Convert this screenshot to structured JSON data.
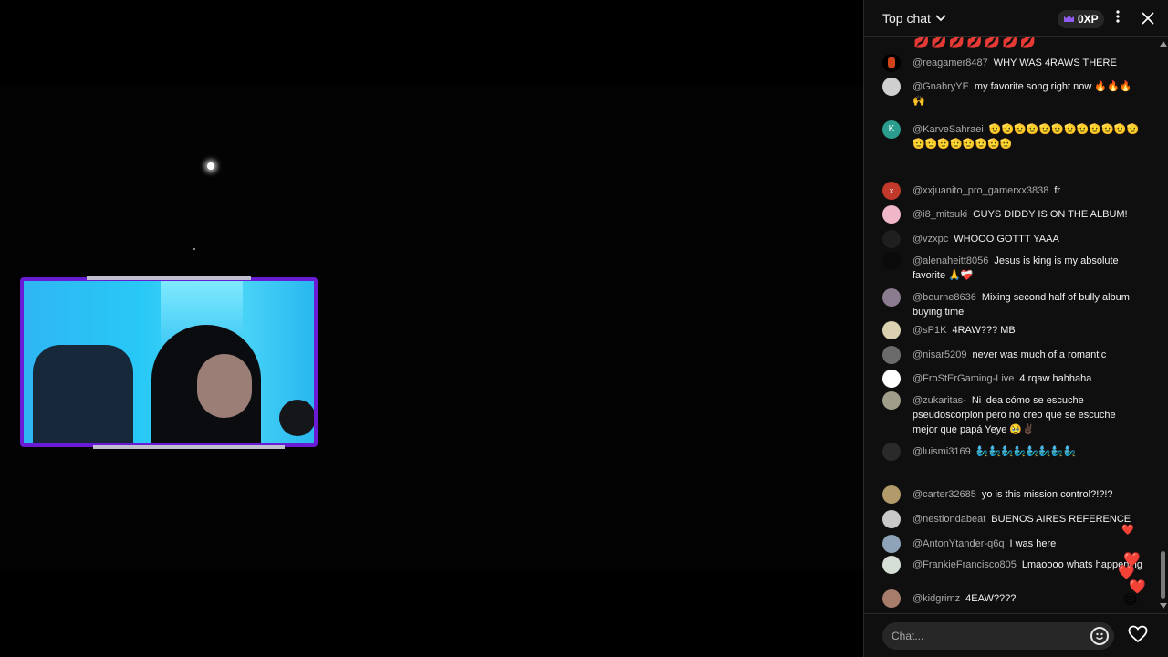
{
  "header": {
    "title": "Top chat",
    "xp": "0XP",
    "menu_icon": "more-vert-icon",
    "close_icon": "close-icon"
  },
  "emoji_strip": "💋💋💋💋💋💋💋",
  "messages": [
    {
      "author": "@reagamer8487",
      "text": "WHY WAS 4RAWS THERE",
      "avatar_color": "#c24a1a"
    },
    {
      "author": "@GnabryYE",
      "text": "my favorite song right now 🔥🔥🔥🙌",
      "avatar_color": "#cfcfcf"
    },
    {
      "author": "@KarveSahraei",
      "text": "🫡🫡🫡🫡🫡🫡🫡🫡🫡🫡🫡🫡🫡🫡🫡🫡🫡🫡🫡🫡",
      "avatar_color": "#2a9d8f",
      "avatar_letter": "K"
    },
    {
      "author": "@xxjuanito_pro_gamerxx3838",
      "text": "fr",
      "avatar_color": "#c0392b",
      "avatar_letter": "x"
    },
    {
      "author": "@i8_mitsuki",
      "text": "GUYS DIDDY IS ON THE ALBUM!",
      "avatar_color": "#f0b7c9"
    },
    {
      "author": "@vzxpc",
      "text": "WHOOO GOTTT YAAA",
      "avatar_color": "#1f1f1f"
    },
    {
      "author": "@alenaheitt8056",
      "text": "Jesus is king is my absolute favorite 🙏❤️‍🩹",
      "avatar_color": "#0a0a0a"
    },
    {
      "author": "@bourne8636",
      "text": "Mixing second half of bully album buying time",
      "avatar_color": "#8a7b8f"
    },
    {
      "author": "@sP1K",
      "text": "4RAW??? MB",
      "avatar_color": "#d9d1b0"
    },
    {
      "author": "@nisar5209",
      "text": "never was much of a romantic",
      "avatar_color": "#6b6b6b"
    },
    {
      "author": "@FroStErGaming-Live",
      "text": "4 rqaw hahhaha",
      "avatar_color": "#ffffff"
    },
    {
      "author": "@zukaritas-",
      "text": "Ni idea cómo se escuche pseudoscorpion pero no creo que se escuche mejor que papá Yeye 🥹✌🏿",
      "avatar_color": "#9e9e8a"
    },
    {
      "author": "@luismi3169",
      "text": "🧞‍♂️🧞‍♂️🧞‍♂️🧞‍♂️🧞‍♂️🧞‍♂️🧞‍♂️🧞‍♂️",
      "avatar_color": "#2a2a2a"
    },
    {
      "author": "@carter32685",
      "text": "yo is this mission control?!?!?",
      "avatar_color": "#b39a6a"
    },
    {
      "author": "@nestiondabeat",
      "text": "BUENOS AIRES REFERENCE",
      "avatar_color": "#c9c9c9"
    },
    {
      "author": "@AntonYtander-q6q",
      "text": "I was here",
      "avatar_color": "#8fa3b8"
    },
    {
      "author": "@FrankieFrancisco805",
      "text": "Lmaoooo whats happening",
      "avatar_color": "#d6dfd6"
    },
    {
      "author": "@kidgrimz",
      "text": "4EAW????",
      "avatar_color": "#a67c6b"
    }
  ],
  "reactions": [
    "❤️",
    "❤️",
    "❤️",
    "❤️",
    "😄"
  ],
  "footer": {
    "placeholder": "Chat...",
    "emoji_icon": "smiley-icon",
    "heart_icon": "heart-icon"
  }
}
